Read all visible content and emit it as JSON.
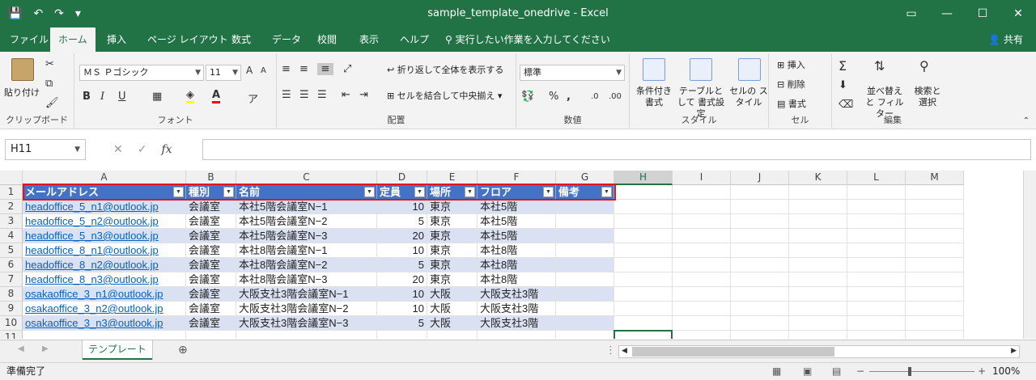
{
  "window": {
    "title": "sample_template_onedrive  -  Excel",
    "qat": {
      "save": "💾",
      "undo": "↶",
      "redo": "↷",
      "customize": "▾"
    },
    "controls": {
      "ribbon_display": "▭",
      "minimize": "—",
      "maximize": "☐",
      "close": "✕"
    }
  },
  "tabs": [
    "ファイル",
    "ホーム",
    "挿入",
    "ページ レイアウト",
    "数式",
    "データ",
    "校閲",
    "表示",
    "ヘルプ"
  ],
  "tell_me": "実行したい作業を入力してください",
  "share": "共有",
  "ribbon": {
    "clipboard": {
      "label": "クリップボード",
      "paste": "貼り付け"
    },
    "font": {
      "label": "フォント",
      "name": "ＭＳ Ｐゴシック",
      "size": "11",
      "bold": "B",
      "italic": "I",
      "underline": "U",
      "grow": "A",
      "shrink": "A"
    },
    "alignment": {
      "label": "配置",
      "wrap": "折り返して全体を表示する",
      "merge": "セルを結合して中央揃え"
    },
    "number": {
      "label": "数値",
      "format": "標準",
      "percent": "%",
      "comma": ","
    },
    "styles": {
      "label": "スタイル",
      "conditional": "条件付き 書式",
      "as_table": "テーブルとして 書式設定",
      "cell_styles": "セルの スタイル"
    },
    "cells": {
      "label": "セル",
      "insert": "挿入",
      "delete": "削除",
      "format": "書式"
    },
    "editing": {
      "label": "編集",
      "sort": "並べ替えと フィルター",
      "find": "検索と 選択"
    }
  },
  "formula_bar": {
    "name_box": "H11",
    "cancel": "✕",
    "enter": "✓",
    "fx": "fx",
    "value": ""
  },
  "columns": [
    "A",
    "B",
    "C",
    "D",
    "E",
    "F",
    "G",
    "H",
    "I",
    "J",
    "K",
    "L",
    "M"
  ],
  "row_numbers": [
    "1",
    "2",
    "3",
    "4",
    "5",
    "6",
    "7",
    "8",
    "9",
    "10",
    "11"
  ],
  "table": {
    "headers": [
      "メールアドレス",
      "種別",
      "名前",
      "定員",
      "場所",
      "フロア",
      "備考"
    ],
    "rows": [
      [
        "headoffice_5_n1@outlook.jp",
        "会議室",
        "本社5階会議室N−1",
        "10",
        "東京",
        "本社5階",
        ""
      ],
      [
        "headoffice_5_n2@outlook.jp",
        "会議室",
        "本社5階会議室N−2",
        "5",
        "東京",
        "本社5階",
        ""
      ],
      [
        "headoffice_5_n3@outlook.jp",
        "会議室",
        "本社5階会議室N−3",
        "20",
        "東京",
        "本社5階",
        ""
      ],
      [
        "headoffice_8_n1@outlook.jp",
        "会議室",
        "本社8階会議室N−1",
        "10",
        "東京",
        "本社8階",
        ""
      ],
      [
        "headoffice_8_n2@outlook.jp",
        "会議室",
        "本社8階会議室N−2",
        "5",
        "東京",
        "本社8階",
        ""
      ],
      [
        "headoffice_8_n3@outlook.jp",
        "会議室",
        "本社8階会議室N−3",
        "20",
        "東京",
        "本社8階",
        ""
      ],
      [
        "osakaoffice_3_n1@outlook.jp",
        "会議室",
        "大阪支社3階会議室N−1",
        "10",
        "大阪",
        "大阪支社3階",
        ""
      ],
      [
        "osakaoffice_3_n2@outlook.jp",
        "会議室",
        "大阪支社3階会議室N−2",
        "10",
        "大阪",
        "大阪支社3階",
        ""
      ],
      [
        "osakaoffice_3_n3@outlook.jp",
        "会議室",
        "大阪支社3階会議室N−3",
        "5",
        "大阪",
        "大阪支社3階",
        ""
      ]
    ]
  },
  "sheet_tab": "テンプレート",
  "status": "準備完了",
  "zoom": "100%",
  "colors": {
    "excel_green": "#217346",
    "table_header": "#4472c4",
    "table_band": "#d9e1f2",
    "highlight": "#e0161e",
    "link": "#0563c1"
  }
}
